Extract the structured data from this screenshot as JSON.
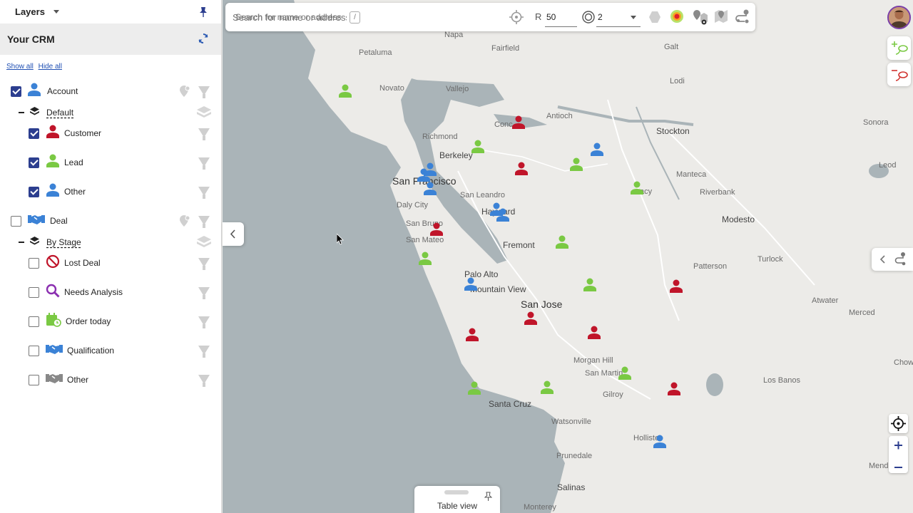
{
  "sidebar": {
    "header_title": "Layers",
    "crm_title": "Your CRM",
    "show_all": "Show all",
    "hide_all": "Hide all",
    "account": {
      "label": "Account",
      "checked": true
    },
    "account_group": {
      "label": "Default"
    },
    "account_items": [
      {
        "label": "Customer",
        "checked": true,
        "color": "#c0152a"
      },
      {
        "label": "Lead",
        "checked": true,
        "color": "#7ac943"
      },
      {
        "label": "Other",
        "checked": true,
        "color": "#3b82d6"
      }
    ],
    "deal": {
      "label": "Deal",
      "checked": false
    },
    "deal_group": {
      "label": "By Stage"
    },
    "deal_items": [
      {
        "label": "Lost Deal",
        "checked": false,
        "icon": "no-entry-icon"
      },
      {
        "label": "Needs Analysis",
        "checked": false,
        "icon": "magnifier-icon"
      },
      {
        "label": "Order today",
        "checked": false,
        "icon": "calendar-clock-icon"
      },
      {
        "label": "Qualification",
        "checked": false,
        "icon": "handshake-icon"
      },
      {
        "label": "Other",
        "checked": false,
        "icon": "handshake-gray-icon"
      }
    ]
  },
  "search": {
    "placeholder": "Search for name or address",
    "shortcut": "/",
    "radius_label": "R",
    "radius_value": "50",
    "count_value": "2"
  },
  "map": {
    "cities": [
      {
        "name": "Napa",
        "cls": ""
      },
      {
        "name": "Petaluma",
        "cls": ""
      },
      {
        "name": "Fairfield",
        "cls": ""
      },
      {
        "name": "Galt",
        "cls": ""
      },
      {
        "name": "Novato",
        "cls": ""
      },
      {
        "name": "Vallejo",
        "cls": ""
      },
      {
        "name": "Lodi",
        "cls": ""
      },
      {
        "name": "Antioch",
        "cls": ""
      },
      {
        "name": "Conc",
        "cls": ""
      },
      {
        "name": "Stockton",
        "cls": "big"
      },
      {
        "name": "Richmond",
        "cls": ""
      },
      {
        "name": "Berkeley",
        "cls": "big"
      },
      {
        "name": "Sonora",
        "cls": ""
      },
      {
        "name": "Manteca",
        "cls": ""
      },
      {
        "name": "Leod",
        "cls": ""
      },
      {
        "name": "San Francisco",
        "cls": "xl"
      },
      {
        "name": "acy",
        "cls": ""
      },
      {
        "name": "Riverbank",
        "cls": ""
      },
      {
        "name": "San Leandro",
        "cls": ""
      },
      {
        "name": "Daly City",
        "cls": ""
      },
      {
        "name": "Hayward",
        "cls": "big"
      },
      {
        "name": "Modesto",
        "cls": "big"
      },
      {
        "name": "San Bruno",
        "cls": ""
      },
      {
        "name": "San Mateo",
        "cls": ""
      },
      {
        "name": "Fremont",
        "cls": "big"
      },
      {
        "name": "Patterson",
        "cls": ""
      },
      {
        "name": "Turlock",
        "cls": ""
      },
      {
        "name": "Palo Alto",
        "cls": "big"
      },
      {
        "name": "Mountain View",
        "cls": "big"
      },
      {
        "name": "San Jose",
        "cls": "xl"
      },
      {
        "name": "Atwater",
        "cls": ""
      },
      {
        "name": "Merced",
        "cls": ""
      },
      {
        "name": "Morgan Hill",
        "cls": ""
      },
      {
        "name": "San Martin",
        "cls": ""
      },
      {
        "name": "Chowchil",
        "cls": ""
      },
      {
        "name": "Los Banos",
        "cls": ""
      },
      {
        "name": "Gilroy",
        "cls": ""
      },
      {
        "name": "Santa Cruz",
        "cls": "big"
      },
      {
        "name": "Watsonville",
        "cls": ""
      },
      {
        "name": "Hollister",
        "cls": ""
      },
      {
        "name": "Prunedale",
        "cls": ""
      },
      {
        "name": "Mendota",
        "cls": ""
      },
      {
        "name": "Salinas",
        "cls": "big"
      },
      {
        "name": "Monterey",
        "cls": ""
      }
    ],
    "markers": [
      {
        "type": "lead"
      },
      {
        "type": "customer"
      },
      {
        "type": "lead"
      },
      {
        "type": "other"
      },
      {
        "type": "customer"
      },
      {
        "type": "lead"
      },
      {
        "type": "other"
      },
      {
        "type": "other"
      },
      {
        "type": "other"
      },
      {
        "type": "lead"
      },
      {
        "type": "other"
      },
      {
        "type": "other"
      },
      {
        "type": "customer"
      },
      {
        "type": "lead"
      },
      {
        "type": "lead"
      },
      {
        "type": "other"
      },
      {
        "type": "lead"
      },
      {
        "type": "customer"
      },
      {
        "type": "customer"
      },
      {
        "type": "customer"
      },
      {
        "type": "customer"
      },
      {
        "type": "lead"
      },
      {
        "type": "lead"
      },
      {
        "type": "lead"
      },
      {
        "type": "customer"
      },
      {
        "type": "other"
      }
    ]
  },
  "table_view": {
    "label": "Table view"
  },
  "colors": {
    "customer": "#c0152a",
    "lead": "#7ac943",
    "other": "#3b82d6",
    "accent": "#2c3e8f"
  }
}
